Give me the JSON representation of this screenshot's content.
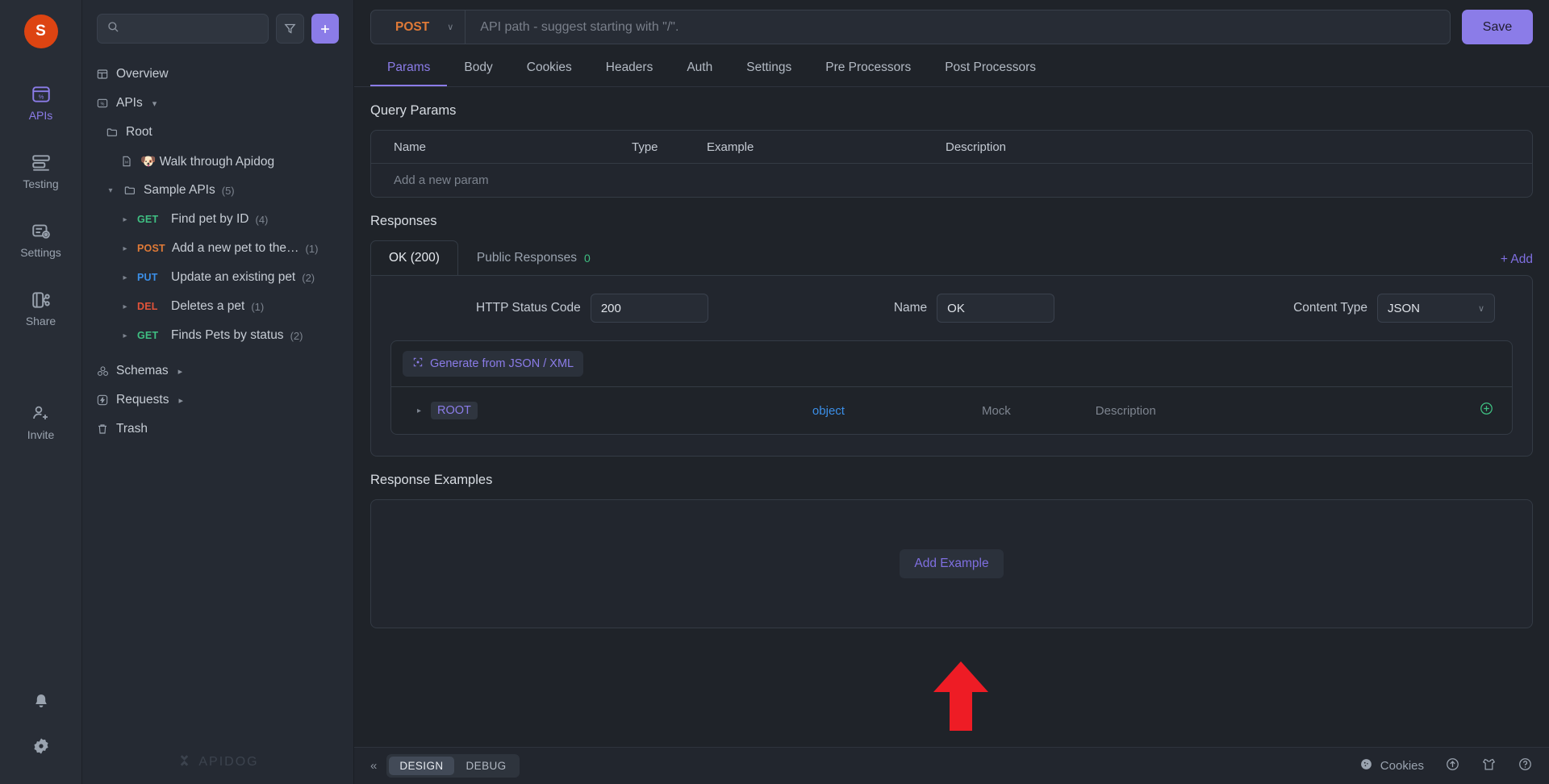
{
  "rail": {
    "avatar_letter": "S",
    "items": [
      {
        "label": "APIs",
        "icon": "apis-icon",
        "active": true
      },
      {
        "label": "Testing",
        "icon": "testing-icon",
        "active": false
      },
      {
        "label": "Settings",
        "icon": "settings-icon",
        "active": false
      },
      {
        "label": "Share",
        "icon": "share-icon",
        "active": false
      },
      {
        "label": "Invite",
        "icon": "invite-icon",
        "active": false
      }
    ],
    "bottom_icons": [
      "bell-icon",
      "gear-icon"
    ]
  },
  "explorer": {
    "search_placeholder": "",
    "search_value": "",
    "filter_icon": "filter-icon",
    "add_icon": "plus-icon",
    "watermark": "APIDOG",
    "tree": {
      "overview": "Overview",
      "apis": "APIs",
      "root": "Root",
      "walk_through": "🐶 Walk through Apidog",
      "sample_apis": "Sample APIs",
      "sample_apis_count": "(5)",
      "endpoints": [
        {
          "method": "GET",
          "name": "Find pet by ID",
          "count": "(4)"
        },
        {
          "method": "POST",
          "name": "Add a new pet to the…",
          "count": "(1)"
        },
        {
          "method": "PUT",
          "name": "Update an existing pet",
          "count": "(2)"
        },
        {
          "method": "DEL",
          "name": "Deletes a pet",
          "count": "(1)"
        },
        {
          "method": "GET",
          "name": "Finds Pets by status",
          "count": "(2)"
        }
      ],
      "schemas": "Schemas",
      "requests": "Requests",
      "trash": "Trash"
    }
  },
  "main": {
    "method": "POST",
    "path_placeholder": "API path - suggest starting with \"/\".",
    "path_value": "",
    "save_label": "Save",
    "tabs": [
      {
        "label": "Params",
        "active": true
      },
      {
        "label": "Body",
        "active": false
      },
      {
        "label": "Cookies",
        "active": false
      },
      {
        "label": "Headers",
        "active": false
      },
      {
        "label": "Auth",
        "active": false
      },
      {
        "label": "Settings",
        "active": false
      },
      {
        "label": "Pre Processors",
        "active": false
      },
      {
        "label": "Post Processors",
        "active": false
      }
    ],
    "query_params": {
      "title": "Query Params",
      "columns": [
        "Name",
        "Type",
        "Example",
        "Description"
      ],
      "add_row_placeholder": "Add a new param"
    },
    "responses": {
      "title": "Responses",
      "tabs": [
        {
          "label": "OK (200)",
          "badge": "",
          "active": true
        },
        {
          "label": "Public Responses",
          "badge": "0",
          "active": false
        }
      ],
      "add_label": "+ Add",
      "status_code_label": "HTTP Status Code",
      "status_code_value": "200",
      "name_label": "Name",
      "name_value": "OK",
      "content_type_label": "Content Type",
      "content_type_value": "JSON",
      "generate_label": "Generate from JSON / XML",
      "schema_row": {
        "name": "ROOT",
        "type": "object",
        "mock": "Mock",
        "description": "Description"
      }
    },
    "response_examples": {
      "title": "Response Examples",
      "add_example_label": "Add Example"
    }
  },
  "statusbar": {
    "collapse_icon": "collapse-icon",
    "modes": [
      {
        "label": "DESIGN",
        "active": true
      },
      {
        "label": "DEBUG",
        "active": false
      }
    ],
    "cookies_label": "Cookies",
    "right_icons": [
      "upload-icon",
      "shirt-icon",
      "help-icon"
    ]
  },
  "annotation": {
    "arrow_color": "#ee1c25"
  },
  "colors": {
    "accent": "#8b7ce8",
    "get": "#3fbf82",
    "post": "#e07a37",
    "put": "#3b8fe8",
    "del": "#e2533a",
    "arrow": "#ee1c25"
  }
}
